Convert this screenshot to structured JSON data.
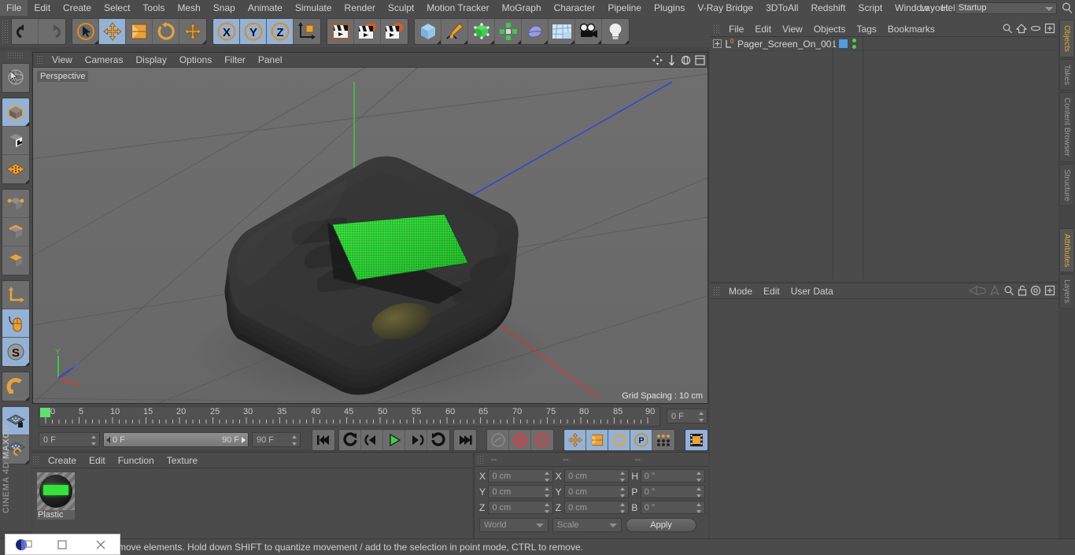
{
  "app": {
    "name": "MAXON CINEMA 4D",
    "brand_line1": "MAXON",
    "brand_line2": "CINEMA 4D"
  },
  "menubar": {
    "items": [
      {
        "label": "File"
      },
      {
        "label": "Edit"
      },
      {
        "label": "Create"
      },
      {
        "label": "Select"
      },
      {
        "label": "Tools"
      },
      {
        "label": "Mesh"
      },
      {
        "label": "Snap"
      },
      {
        "label": "Animate"
      },
      {
        "label": "Simulate"
      },
      {
        "label": "Render"
      },
      {
        "label": "Sculpt"
      },
      {
        "label": "Motion Tracker"
      },
      {
        "label": "MoGraph"
      },
      {
        "label": "Character"
      },
      {
        "label": "Pipeline"
      },
      {
        "label": "Plugins"
      },
      {
        "label": "V-Ray Bridge"
      },
      {
        "label": "3DToAll"
      },
      {
        "label": "Redshift"
      },
      {
        "label": "Script"
      },
      {
        "label": "Window"
      },
      {
        "label": "Help"
      }
    ],
    "layout_label": "Layout:",
    "layout_value": "Startup",
    "search_icon": "search-icon"
  },
  "toolbar": {
    "groups": [
      {
        "name": "undo-redo",
        "buttons": [
          {
            "icon": "undo-icon",
            "selected": false
          },
          {
            "icon": "redo-icon",
            "selected": false
          }
        ]
      },
      {
        "name": "transform-tools",
        "buttons": [
          {
            "icon": "select-live-icon",
            "selected": false
          },
          {
            "icon": "move-icon",
            "selected": true
          },
          {
            "icon": "scale-icon",
            "selected": false
          },
          {
            "icon": "rotate-icon",
            "selected": false
          },
          {
            "icon": "move-alt-icon",
            "selected": false
          }
        ]
      },
      {
        "name": "axis-locks",
        "buttons": [
          {
            "icon": "lock-x-icon",
            "selected": true
          },
          {
            "icon": "lock-y-icon",
            "selected": true
          },
          {
            "icon": "lock-z-icon",
            "selected": true
          },
          {
            "icon": "world-object-axis-icon",
            "selected": false
          }
        ]
      },
      {
        "name": "render-tools",
        "buttons": [
          {
            "icon": "render-view-icon",
            "selected": false
          },
          {
            "icon": "render-region-icon",
            "selected": false
          },
          {
            "icon": "render-settings-icon",
            "selected": false
          }
        ]
      },
      {
        "name": "create-objects",
        "buttons": [
          {
            "icon": "cube-primitive-icon",
            "selected": false
          },
          {
            "icon": "spline-pen-icon",
            "selected": false
          },
          {
            "icon": "generator-icon",
            "selected": false
          },
          {
            "icon": "mograph-icon",
            "selected": false
          },
          {
            "icon": "deformer-icon",
            "selected": false
          },
          {
            "icon": "environment-icon",
            "selected": false
          },
          {
            "icon": "camera-icon",
            "selected": false
          },
          {
            "icon": "light-icon",
            "selected": false
          }
        ]
      }
    ]
  },
  "left_toolbar": {
    "groups": [
      {
        "buttons": [
          {
            "icon": "live-selection-icon",
            "selected": false
          }
        ]
      },
      {
        "buttons": [
          {
            "icon": "model-mode-icon",
            "selected": true
          },
          {
            "icon": "texture-mode-icon",
            "selected": false
          },
          {
            "icon": "uv-mode-icon",
            "selected": false
          }
        ]
      },
      {
        "buttons": [
          {
            "icon": "point-mode-icon",
            "selected": false
          },
          {
            "icon": "edge-mode-icon",
            "selected": false
          },
          {
            "icon": "polygon-mode-icon",
            "selected": false
          }
        ]
      },
      {
        "buttons": [
          {
            "icon": "axis-mode-icon",
            "selected": false
          },
          {
            "icon": "enable-axis-icon",
            "selected": true
          },
          {
            "icon": "soft-selection-icon",
            "selected": true
          }
        ]
      },
      {
        "buttons": [
          {
            "icon": "snap-magnet-icon",
            "selected": false
          }
        ]
      },
      {
        "buttons": [
          {
            "icon": "workplane-lock-icon",
            "selected": true
          },
          {
            "icon": "workplane-rotate-icon",
            "selected": false
          }
        ]
      }
    ]
  },
  "viewport": {
    "menu": [
      {
        "label": "View"
      },
      {
        "label": "Cameras"
      },
      {
        "label": "Display"
      },
      {
        "label": "Options"
      },
      {
        "label": "Filter"
      },
      {
        "label": "Panel"
      }
    ],
    "camera_label": "Perspective",
    "grid_spacing": "Grid Spacing : 10 cm",
    "axis_x": "X",
    "axis_y": "Y",
    "axis_z": "Z",
    "controls": [
      {
        "icon": "pan-view-icon"
      },
      {
        "icon": "zoom-view-icon"
      },
      {
        "icon": "rotate-view-icon"
      },
      {
        "icon": "maximize-view-icon"
      }
    ],
    "model": {
      "name": "pager-device",
      "body_color": "#313131",
      "screen_color": "#2fd437",
      "screen_label": "pager-lcd-screen"
    },
    "colors": {
      "background": "#6b6b6b",
      "axis_x": "#d33b3b",
      "axis_y": "#4fc44f",
      "axis_z": "#3a43cf"
    }
  },
  "timeline": {
    "ticks": [
      "0",
      "5",
      "10",
      "15",
      "20",
      "25",
      "30",
      "35",
      "40",
      "45",
      "50",
      "55",
      "60",
      "65",
      "70",
      "75",
      "80",
      "85",
      "90"
    ],
    "current_frame_marker": "0",
    "current_frame": "0 F",
    "range_start": "0 F",
    "range_end": "90 F",
    "end_frame": "90 F",
    "frame_field_right": "0 F",
    "transport": [
      {
        "icon": "go-to-start-icon",
        "selected": false
      },
      {
        "icon": "play-backward-loop-icon",
        "selected": false
      },
      {
        "icon": "step-back-icon",
        "selected": false
      },
      {
        "icon": "play-icon",
        "selected": false
      },
      {
        "icon": "step-forward-icon",
        "selected": false
      },
      {
        "icon": "play-forward-loop-icon",
        "selected": false
      },
      {
        "icon": "go-to-end-icon",
        "selected": false
      }
    ],
    "record_group": [
      {
        "icon": "autokey-icon",
        "selected": false
      },
      {
        "icon": "record-keyframe-icon",
        "selected": false
      },
      {
        "icon": "keyframe-selection-icon",
        "selected": false
      }
    ],
    "key_group": [
      {
        "icon": "key-position-icon",
        "selected": true
      },
      {
        "icon": "key-scale-icon",
        "selected": true
      },
      {
        "icon": "key-rotation-icon",
        "selected": true
      },
      {
        "icon": "key-param-icon",
        "selected": true
      },
      {
        "icon": "key-pla-icon",
        "selected": false
      }
    ],
    "filmstrip": {
      "icon": "timeline-filmstrip-icon",
      "selected": true
    }
  },
  "material_manager": {
    "menu": [
      {
        "label": "Create"
      },
      {
        "label": "Edit"
      },
      {
        "label": "Function"
      },
      {
        "label": "Texture"
      }
    ],
    "materials": [
      {
        "name": "Plastic",
        "swatch_color": "#37e03a"
      }
    ]
  },
  "coordinates": {
    "header_dashes": [
      "--",
      "--",
      "--"
    ],
    "rows": [
      {
        "label1": "X",
        "value1": "0 cm",
        "label2": "X",
        "value2": "0 cm",
        "label3": "H",
        "value3": "0 °"
      },
      {
        "label1": "Y",
        "value1": "0 cm",
        "label2": "Y",
        "value2": "0 cm",
        "label3": "P",
        "value3": "0 °"
      },
      {
        "label1": "Z",
        "value1": "0 cm",
        "label2": "Z",
        "value2": "0 cm",
        "label3": "B",
        "value3": "0 °"
      }
    ],
    "system": "World",
    "mode": "Scale",
    "apply_label": "Apply"
  },
  "object_manager": {
    "menu": [
      {
        "label": "File"
      },
      {
        "label": "Edit"
      },
      {
        "label": "View"
      },
      {
        "label": "Objects"
      },
      {
        "label": "Tags"
      },
      {
        "label": "Bookmarks"
      }
    ],
    "icons": [
      {
        "icon": "search-icon"
      },
      {
        "icon": "home-icon"
      },
      {
        "icon": "eye-icon"
      },
      {
        "icon": "expand-icon"
      }
    ],
    "rows": [
      {
        "name": "Pager_Screen_On_001",
        "layer_index": "0",
        "tag": "material-tag"
      }
    ]
  },
  "attributes": {
    "menu": [
      {
        "label": "Mode"
      },
      {
        "label": "Edit"
      },
      {
        "label": "User Data"
      }
    ],
    "icons": [
      {
        "icon": "back-nav-icon"
      },
      {
        "icon": "up-nav-icon"
      },
      {
        "icon": "search-icon"
      },
      {
        "icon": "lock-icon"
      },
      {
        "icon": "target-icon"
      },
      {
        "icon": "expand-icon"
      }
    ]
  },
  "right_tabs": [
    {
      "label": "Objects",
      "active": true
    },
    {
      "label": "Takes",
      "active": false
    },
    {
      "label": "Content Browser",
      "active": false
    },
    {
      "label": "Structure",
      "active": false
    },
    {
      "label": "Attributes",
      "active": true
    },
    {
      "label": "Layers",
      "active": false
    }
  ],
  "statusbar": {
    "message": "move elements. Hold down SHIFT to quantize movement / add to the selection in point mode, CTRL to remove."
  },
  "mini_window": {
    "icons": [
      {
        "icon": "app-logo-icon"
      },
      {
        "icon": "restore-window-icon"
      },
      {
        "icon": "close-window-icon"
      }
    ]
  },
  "colors": {
    "accent_orange": "#e08a1e",
    "selected_blue": "#93b2d6",
    "panel_bg": "#4b4b4b",
    "viewport_bg": "#6b6b6b"
  }
}
